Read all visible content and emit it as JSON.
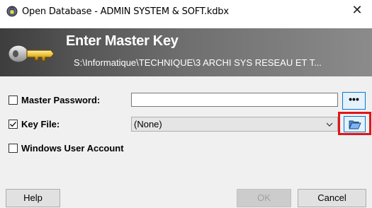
{
  "window": {
    "title": "Open Database - ADMIN SYSTEM & SOFT.kdbx",
    "close_glyph": "✕"
  },
  "banner": {
    "title": "Enter Master Key",
    "path": "S:\\Informatique\\TECHNIQUE\\3 ARCHI SYS RESEAU ET T..."
  },
  "form": {
    "master_password": {
      "label": "Master Password:",
      "checked": false,
      "value": "",
      "reveal_button_label": "•••"
    },
    "key_file": {
      "label": "Key File:",
      "checked": true,
      "selected": "(None)",
      "browse_icon": "folder-open-icon",
      "browse_highlighted": true
    },
    "windows_user_account": {
      "label": "Windows User Account",
      "checked": false
    }
  },
  "buttons": {
    "help": "Help",
    "ok": "OK",
    "cancel": "Cancel"
  },
  "colors": {
    "accent": "#0078d7",
    "highlight": "#e0151b"
  }
}
